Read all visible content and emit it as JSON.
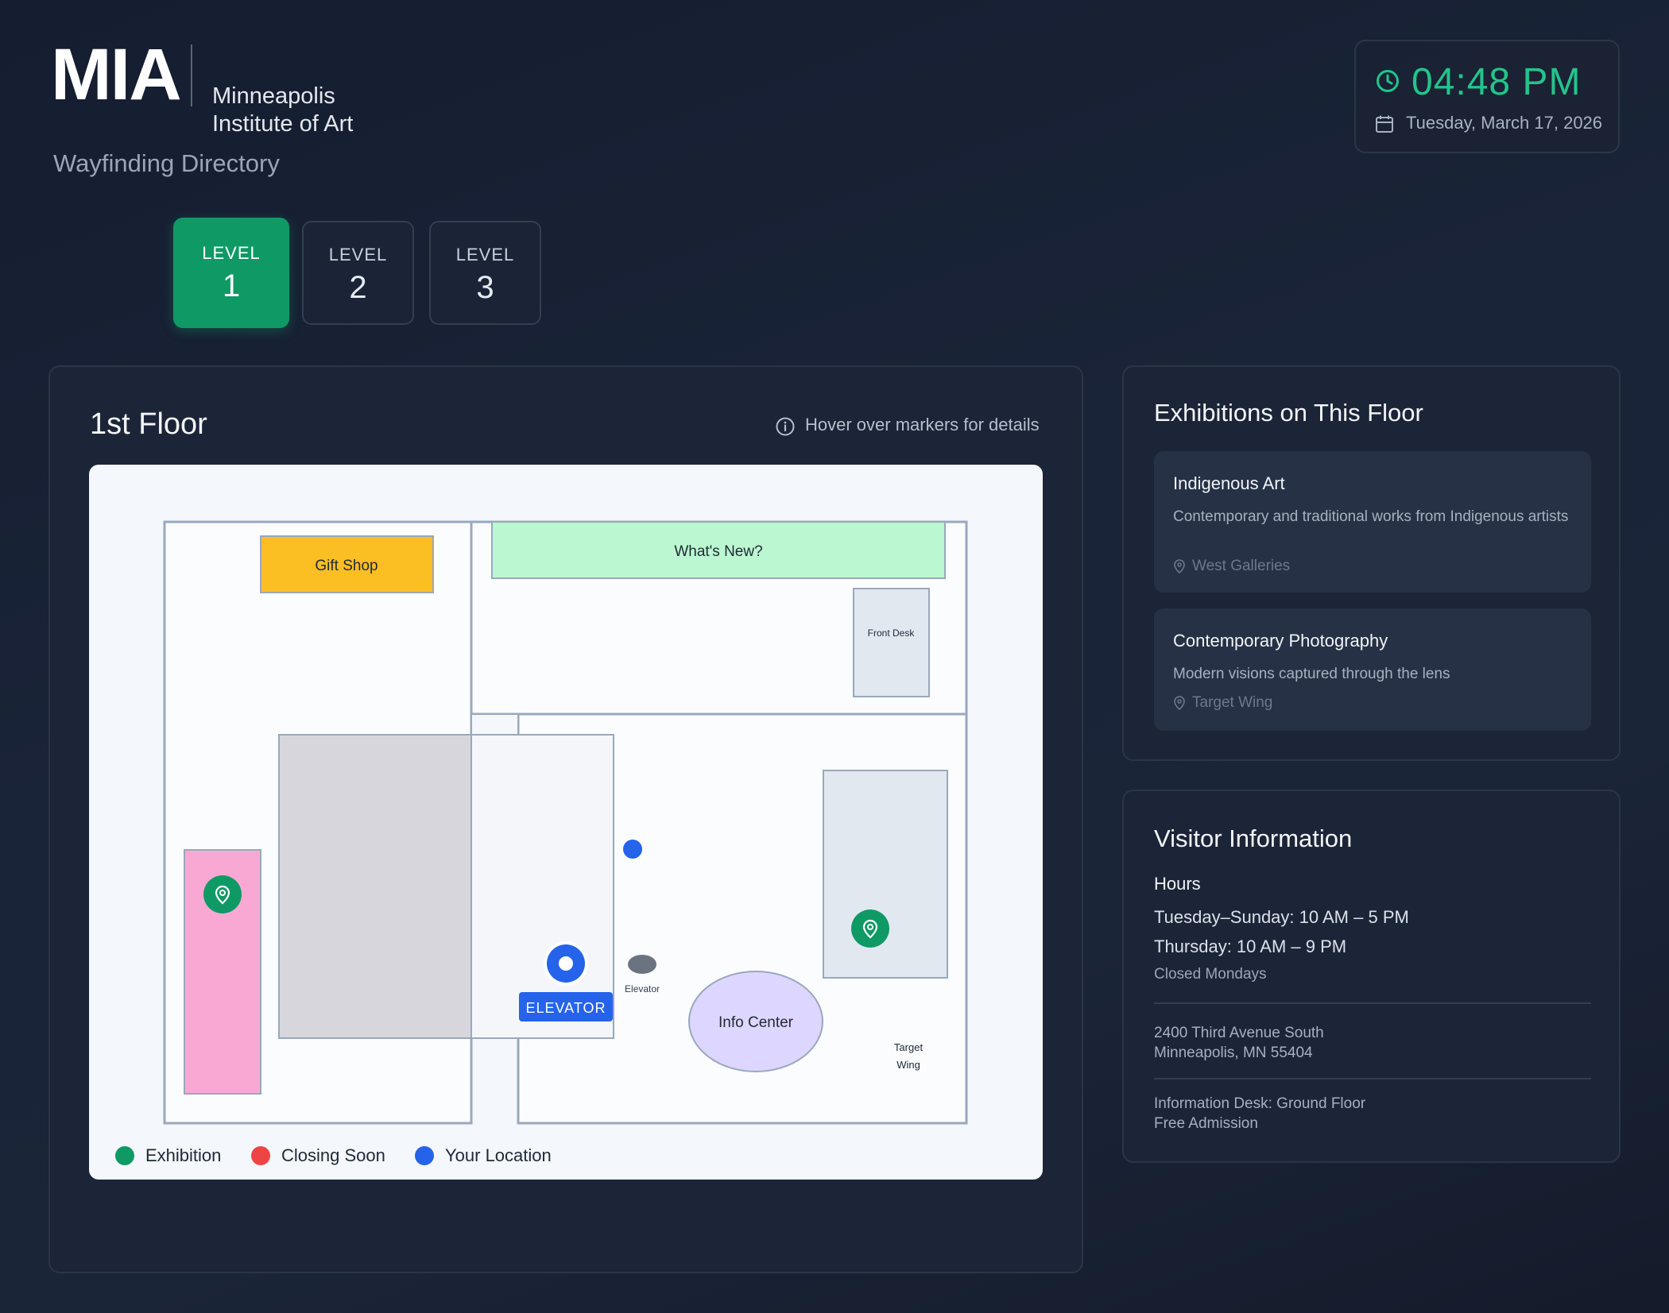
{
  "header": {
    "logo": "MIA",
    "institution_name": "Minneapolis\nInstitute of Art",
    "subtitle": "Wayfinding Directory"
  },
  "clock": {
    "time": "04:48 PM",
    "date": "Tuesday, March 17, 2026",
    "accent_color": "#22c58b"
  },
  "levels": [
    {
      "label": "LEVEL",
      "number": "1",
      "active": true
    },
    {
      "label": "LEVEL",
      "number": "2",
      "active": false
    },
    {
      "label": "LEVEL",
      "number": "3",
      "active": false
    }
  ],
  "map": {
    "floor_title": "1st Floor",
    "hint": "Hover over markers for details",
    "rooms": {
      "gift_shop": "Gift Shop",
      "whats_new": "What's New?",
      "front_desk": "Front Desk",
      "elevator_label": "Elevator",
      "elevator_tag": "ELEVATOR",
      "info_center": "Info Center",
      "target_wing_line1": "Target",
      "target_wing_line2": "Wing"
    },
    "legend": [
      {
        "label": "Exhibition",
        "color": "#0f9a65"
      },
      {
        "label": "Closing Soon",
        "color": "#ef4444"
      },
      {
        "label": "Your Location",
        "color": "#2563eb"
      }
    ],
    "icons": [
      "info-icon",
      "map-pin-icon",
      "location-dot-icon"
    ]
  },
  "exhibitions": {
    "title": "Exhibitions on This Floor",
    "items": [
      {
        "name": "Indigenous Art",
        "description": "Contemporary and traditional works from Indigenous artists",
        "location": "West Galleries"
      },
      {
        "name": "Contemporary Photography",
        "description": "Modern visions captured through the lens",
        "location": "Target Wing"
      }
    ]
  },
  "visitor": {
    "title": "Visitor Information",
    "hours_label": "Hours",
    "hours": [
      "Tuesday–Sunday: 10 AM – 5 PM",
      "Thursday: 10 AM – 9 PM"
    ],
    "closed": "Closed Mondays",
    "address": [
      "2400 Third Avenue South",
      "Minneapolis, MN 55404"
    ],
    "notes": [
      "Information Desk: Ground Floor",
      "Free Admission"
    ]
  }
}
